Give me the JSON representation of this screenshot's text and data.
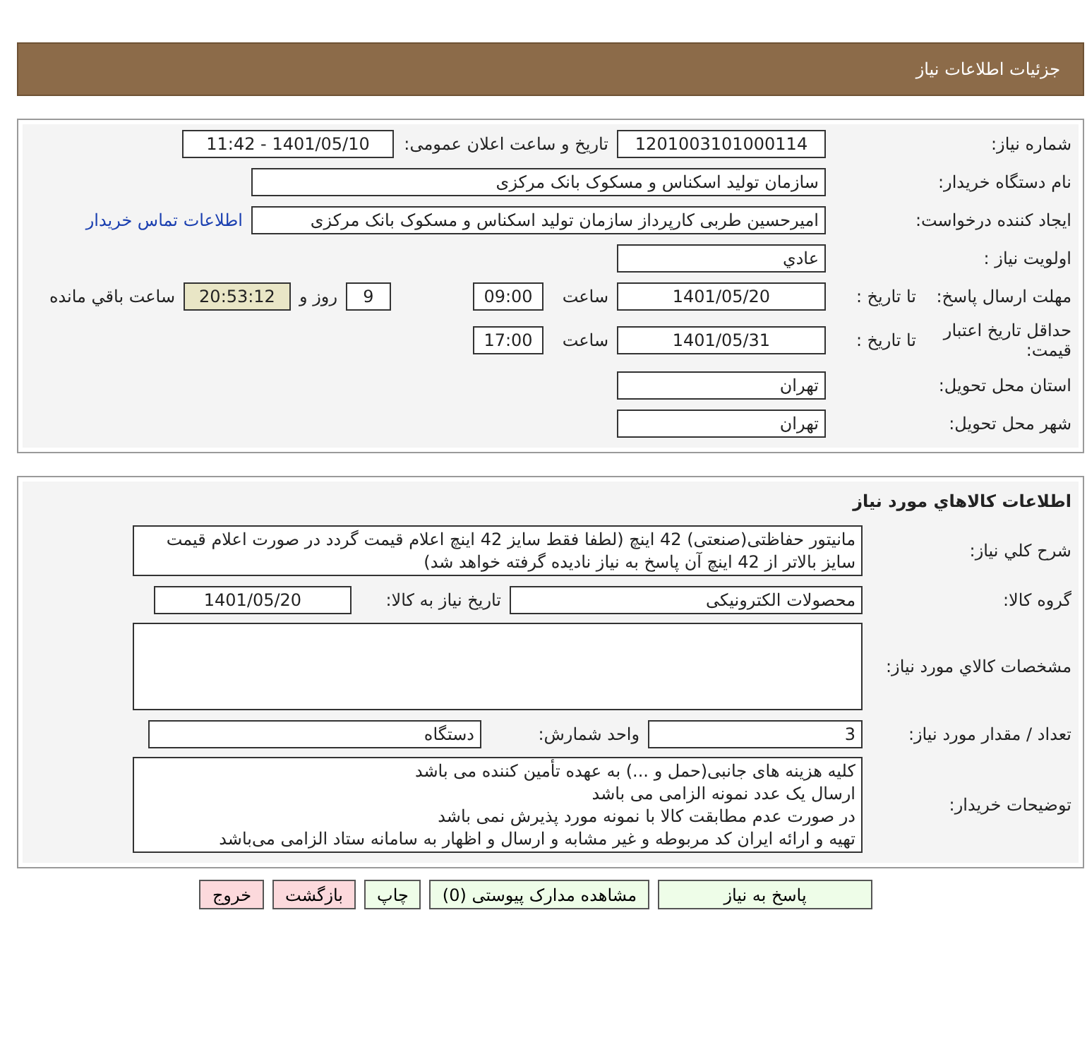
{
  "header": {
    "title": "جزئیات اطلاعات نیاز"
  },
  "details": {
    "need_number": {
      "label": "شماره نیاز:",
      "value": "1201003101000114"
    },
    "announce": {
      "label": "تاریخ و ساعت اعلان عمومی:",
      "value": "1401/05/10 - 11:42"
    },
    "buyer": {
      "label": "نام دستگاه خریدار:",
      "value": "سازمان تولید اسکناس و مسکوک بانک مرکزی"
    },
    "creator": {
      "label": "ایجاد کننده درخواست:",
      "value": "امیرحسین طربی کارپرداز سازمان تولید اسکناس و مسکوک بانک مرکزی",
      "link": "اطلاعات تماس خریدار"
    },
    "priority": {
      "label": "اولویت نیاز :",
      "value": "عادي"
    },
    "deadline": {
      "label": "مهلت ارسال پاسخ:",
      "sublabel": "تا تاریخ :",
      "date": "1401/05/20",
      "time_label": "ساعت",
      "time": "09:00",
      "days": "9",
      "days_label": "روز و",
      "remaining": "20:53:12",
      "remaining_label": "ساعت باقي مانده"
    },
    "validity": {
      "label": "حداقل تاریخ اعتبار قیمت:",
      "sublabel": "تا تاریخ :",
      "date": "1401/05/31",
      "time_label": "ساعت",
      "time": "17:00"
    },
    "province": {
      "label": "استان محل تحویل:",
      "value": "تهران"
    },
    "city": {
      "label": "شهر محل تحویل:",
      "value": "تهران"
    }
  },
  "goods": {
    "title": "اطلاعات کالاهاي مورد نياز",
    "description": {
      "label": "شرح کلي نياز:",
      "value": "مانیتور حفاظتی(صنعتی) 42 اینچ (لطفا فقط سایز 42 اینچ اعلام قیمت گردد در صورت اعلام قیمت سایز بالاتر از 42 اینچ آن پاسخ به نیاز نادیده گرفته خواهد شد)"
    },
    "group": {
      "label": "گروه کالا:",
      "value": "محصولات الکترونیکی",
      "date_label": "تاریخ نیاز به کالا:",
      "date": "1401/05/20"
    },
    "specs": {
      "label": "مشخصات کالاي مورد نياز:"
    },
    "quantity": {
      "label": "تعداد / مقدار مورد نياز:",
      "value": "3",
      "unit_label": "واحد شمارش:",
      "unit": "دستگاه"
    },
    "notes": {
      "label": "توضيحات خريدار:",
      "lines": [
        "کلیه هزینه های جانبی(حمل و ...) به عهده تأمین کننده می باشد",
        "ارسال یک عدد نمونه الزامی می باشد",
        "در صورت عدم مطابقت کالا با نمونه مورد پذیرش نمی باشد",
        "تهیه و ارائه ایران کد مربوطه و غیر مشابه و ارسال و اظهار به سامانه ستاد الزامی می‌باشد"
      ]
    }
  },
  "buttons": [
    {
      "label": "پاسخ به نیاز",
      "kind": "normal"
    },
    {
      "label": "مشاهده مدارک پیوستی (0)",
      "kind": "normal"
    },
    {
      "label": "چاپ",
      "kind": "normal"
    },
    {
      "label": "بازگشت",
      "kind": "exit"
    },
    {
      "label": "خروج",
      "kind": "exit"
    }
  ]
}
